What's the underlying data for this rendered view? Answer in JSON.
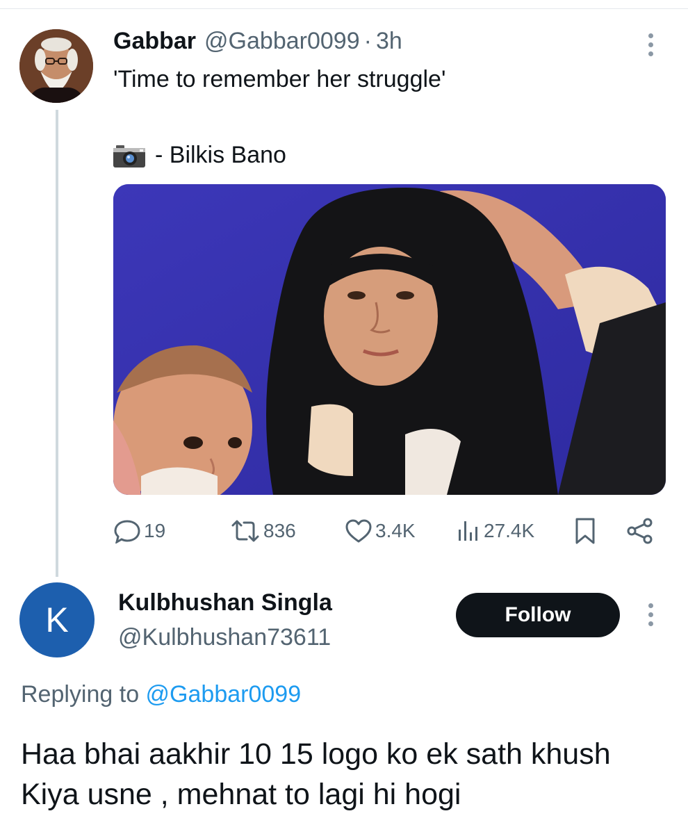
{
  "tweet": {
    "author_name": "Gabbar",
    "author_handle": "@Gabbar0099",
    "separator": "·",
    "time": "3h",
    "text": "'Time to remember her struggle'",
    "caption_icon": "camera-icon",
    "caption": "- Bilkis Bano",
    "stats": {
      "replies": "19",
      "retweets": "836",
      "likes": "3.4K",
      "views": "27.4K"
    }
  },
  "reply": {
    "avatar_letter": "K",
    "author_name": "Kulbhushan Singla",
    "author_handle": "@Kulbhushan73611",
    "follow_label": "Follow",
    "replying_prefix": "Replying to ",
    "replying_handle": "@Gabbar0099",
    "text": "Haa bhai aakhir 10 15 logo ko ek sath khush Kiya usne , mehnat to lagi hi hogi"
  },
  "colors": {
    "text_primary": "#0f1419",
    "text_secondary": "#536471",
    "link": "#1d9bf0",
    "follow_button_bg": "#0f1419",
    "reply_avatar_bg": "#1d5fae",
    "photo_backdrop": "#3b38b4"
  }
}
